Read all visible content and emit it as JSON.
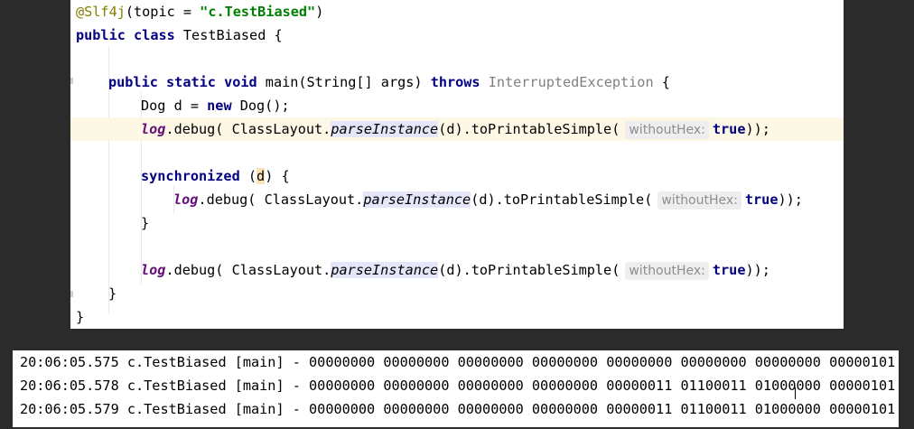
{
  "editor": {
    "annotation": "@Slf4j",
    "annotation_arg": "(topic = ",
    "topic_value": "\"c.TestBiased\"",
    "annotation_close": ")",
    "kw_public": "public",
    "kw_class": "class",
    "class_name": "TestBiased",
    "open_brace": "{",
    "kw_static": "static",
    "kw_void": "void",
    "main_sig": "main(String[] args)",
    "kw_throws": "throws",
    "exception": "InterruptedException",
    "dog_decl": "Dog d = ",
    "kw_new": "new",
    "dog_ctor": "Dog();",
    "log_var": "log",
    "debug_call": ".debug( ClassLayout.",
    "parse_method": "parseInstance",
    "printable_call": "(d).toPrintableSimple(",
    "hint_label": "withoutHex:",
    "kw_true": "true",
    "call_end": "));",
    "kw_synchronized": "synchronized",
    "paren_open": "(",
    "sync_var": "d",
    "paren_close_brace": ") {",
    "close_brace": "}"
  },
  "console": {
    "lines": [
      "20:06:05.575 c.TestBiased [main] - 00000000 00000000 00000000 00000000 00000000 00000000 00000000 00000101",
      "20:06:05.578 c.TestBiased [main] - 00000000 00000000 00000000 00000000 00000011 01100011 01000000 00000101",
      "20:06:05.579 c.TestBiased [main] - 00000000 00000000 00000000 00000000 00000011 01100011 01000000 00000101"
    ]
  }
}
